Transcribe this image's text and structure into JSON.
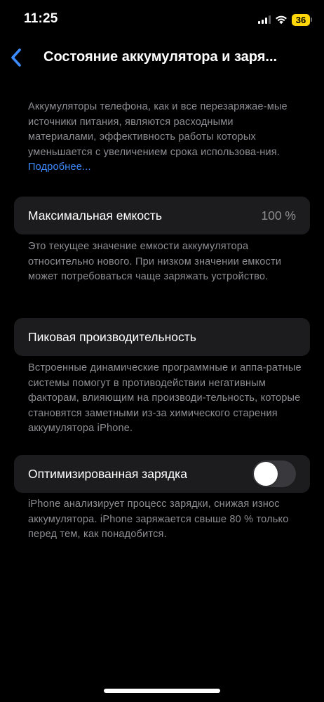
{
  "status_bar": {
    "time": "11:25",
    "battery_level": "36",
    "signal_icon": "cellular-signal-icon",
    "wifi_icon": "wifi-icon",
    "battery_color": "#ffd60a"
  },
  "nav": {
    "back_icon": "chevron-left-icon",
    "title": "Состояние аккумулятора и заря..."
  },
  "intro": {
    "text": "Аккумуляторы телефона, как и все перезаряжае-мые источники питания, являются расходными материалами, эффективность работы которых уменьшается с увеличением срока использова-ния.",
    "link": "Подробнее..."
  },
  "max_capacity": {
    "label": "Максимальная емкость",
    "value": "100 %",
    "footnote": "Это текущее значение емкости аккумулятора относительно нового. При низком значении емкости может потребоваться чаще заряжать устройство."
  },
  "peak_performance": {
    "label": "Пиковая производительность",
    "footnote": "Встроенные динамические программные и аппа-ратные системы помогут в противодействии негативным факторам, влияющим на производи-тельность, которые становятся заметными из-за химического старения аккумулятора iPhone."
  },
  "optimized_charging": {
    "label": "Оптимизированная зарядка",
    "enabled": false,
    "footnote": "iPhone анализирует процесс зарядки, снижая износ аккумулятора. iPhone заряжается свыше 80 % только перед тем, как понадобится."
  },
  "colors": {
    "accent": "#3c8cff",
    "background": "#000000",
    "cell": "#1c1c1e",
    "secondary_text": "#8e8e93"
  }
}
